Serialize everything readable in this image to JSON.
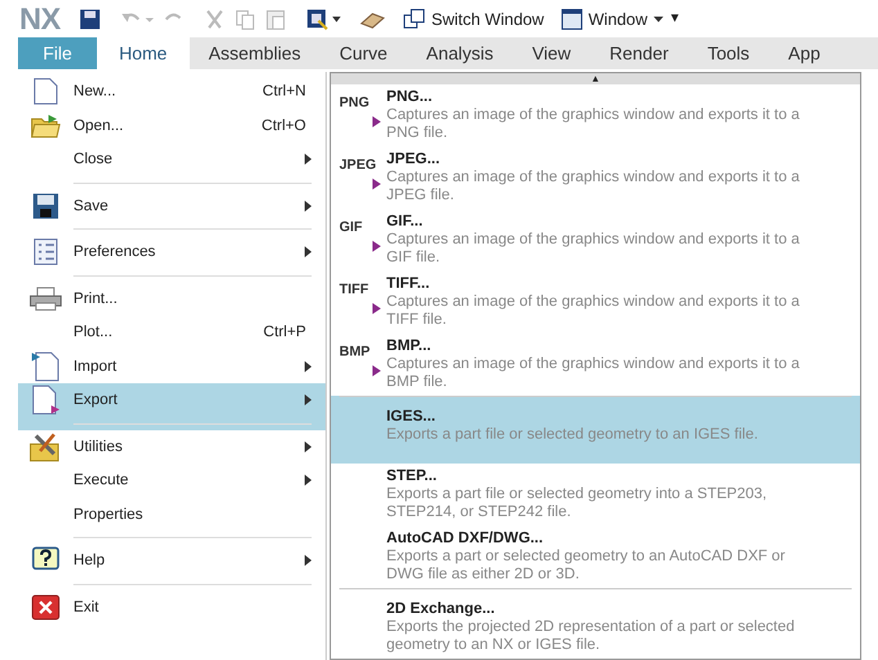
{
  "toolbar": {
    "logo": "NX",
    "switch_window": "Switch Window",
    "window_menu": "Window",
    "overflow": "▾"
  },
  "ribbon_tabs": [
    {
      "label": "File",
      "kind": "file",
      "selected": false
    },
    {
      "label": "Home",
      "kind": "tab",
      "selected": true
    },
    {
      "label": "Assemblies",
      "kind": "tab",
      "selected": false
    },
    {
      "label": "Curve",
      "kind": "tab",
      "selected": false
    },
    {
      "label": "Analysis",
      "kind": "tab",
      "selected": false
    },
    {
      "label": "View",
      "kind": "tab",
      "selected": false
    },
    {
      "label": "Render",
      "kind": "tab",
      "selected": false
    },
    {
      "label": "Tools",
      "kind": "tab",
      "selected": false
    },
    {
      "label": "App",
      "kind": "tab",
      "selected": false
    }
  ],
  "file_menu": [
    {
      "label": "New...",
      "shortcut": "Ctrl+N",
      "submenu": false,
      "divider_after": false,
      "selected": false
    },
    {
      "label": "Open...",
      "shortcut": "Ctrl+O",
      "submenu": false,
      "divider_after": false,
      "selected": false
    },
    {
      "label": "Close",
      "submenu": true,
      "divider_after": true,
      "selected": false
    },
    {
      "label": "Save",
      "submenu": true,
      "divider_after": true,
      "selected": false
    },
    {
      "label": "Preferences",
      "submenu": true,
      "divider_after": true,
      "selected": false
    },
    {
      "label": "Print...",
      "submenu": false,
      "divider_after": false,
      "selected": false
    },
    {
      "label": "Plot...",
      "shortcut": "Ctrl+P",
      "submenu": false,
      "divider_after": false,
      "selected": false
    },
    {
      "label": "Import",
      "submenu": true,
      "divider_after": false,
      "selected": false
    },
    {
      "label": "Export",
      "submenu": true,
      "divider_after": true,
      "selected": true
    },
    {
      "label": "Utilities",
      "submenu": true,
      "divider_after": false,
      "selected": false
    },
    {
      "label": "Execute",
      "submenu": true,
      "divider_after": false,
      "selected": false
    },
    {
      "label": "Properties",
      "submenu": false,
      "divider_after": true,
      "selected": false
    },
    {
      "label": "Help",
      "submenu": true,
      "divider_after": true,
      "selected": false
    },
    {
      "label": "Exit",
      "submenu": false,
      "divider_after": false,
      "selected": false
    }
  ],
  "export_menu": {
    "scroll_up": "▲",
    "items": [
      {
        "kind": "image",
        "badge": "PNG",
        "title": "PNG...",
        "description": "Captures an image of the graphics window and exports it to a PNG file.",
        "selected": false,
        "divider_before": false
      },
      {
        "kind": "image",
        "badge": "JPEG",
        "title": "JPEG...",
        "description": "Captures an image of the graphics window and exports it to a JPEG file.",
        "selected": false,
        "divider_before": false
      },
      {
        "kind": "image",
        "badge": "GIF",
        "title": "GIF...",
        "description": "Captures an image of the graphics window and exports it to a GIF file.",
        "selected": false,
        "divider_before": false
      },
      {
        "kind": "image",
        "badge": "TIFF",
        "title": "TIFF...",
        "description": "Captures an image of the graphics window and exports it to a TIFF file.",
        "selected": false,
        "divider_before": false
      },
      {
        "kind": "image",
        "badge": "BMP",
        "title": "BMP...",
        "description": "Captures an image of the graphics window and exports it to a BMP file.",
        "selected": false,
        "divider_before": false
      },
      {
        "kind": "format",
        "title": "IGES...",
        "description": "Exports a part file or selected geometry to an IGES file.",
        "selected": true,
        "divider_before": true
      },
      {
        "kind": "format",
        "title": "STEP...",
        "description": "Exports a part file or selected geometry into a STEP203, STEP214, or STEP242 file.",
        "selected": false,
        "divider_before": false
      },
      {
        "kind": "format",
        "title": "AutoCAD DXF/DWG...",
        "description": "Exports a part or selected geometry to an AutoCAD DXF or DWG file as either 2D or 3D.",
        "selected": false,
        "divider_before": false
      },
      {
        "kind": "format",
        "title": "2D Exchange...",
        "description": "Exports the projected 2D representation of a part or selected geometry to an NX or IGES file.",
        "selected": false,
        "divider_before": true
      }
    ]
  }
}
